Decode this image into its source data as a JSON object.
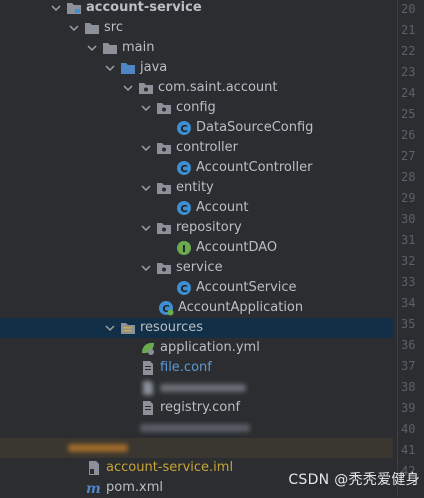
{
  "tree": {
    "root": "account-service",
    "src": "src",
    "main": "main",
    "java": "java",
    "package": "com.saint.account",
    "config_folder": "config",
    "datasource_config": "DataSourceConfig",
    "controller_folder": "controller",
    "account_controller": "AccountController",
    "entity_folder": "entity",
    "account": "Account",
    "repository_folder": "repository",
    "account_dao": "AccountDAO",
    "service_folder": "service",
    "account_service": "AccountService",
    "account_application": "AccountApplication",
    "resources": "resources",
    "application_yml": "application.yml",
    "file_conf": "file.conf",
    "registry_conf": "registry.conf",
    "iml": "account-service.iml",
    "pom": "pom.xml"
  },
  "gutter_numbers": [
    "20",
    "21",
    "22",
    "23",
    "24",
    "25",
    "26",
    "27",
    "28",
    "29",
    "30",
    "31",
    "32",
    "33",
    "34",
    "35",
    "36",
    "37",
    "38",
    "39",
    "40",
    "41",
    "42"
  ],
  "watermark": "CSDN @秃秃爱健身",
  "colors": {
    "background": "#2b2d30",
    "selection": "#113048",
    "folder": "#8b9099",
    "source_folder": "#4f86c6",
    "class_icon": "#3d8fd1",
    "interface_icon": "#6aaa50",
    "modified_text": "#5c9ad5",
    "ignored_text": "#c6a437"
  }
}
